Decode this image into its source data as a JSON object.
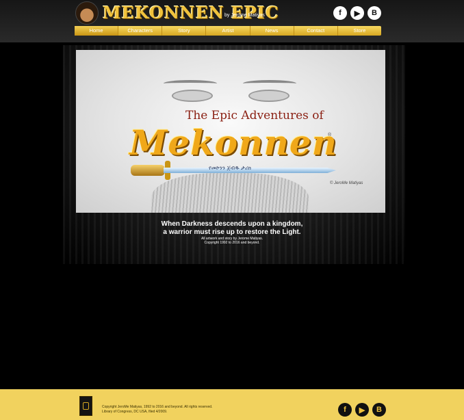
{
  "header": {
    "logo_text": "MEKONNEN EPIC",
    "byline": "by Jerome Matiyas",
    "social": [
      {
        "icon": "facebook-icon",
        "glyph": "f"
      },
      {
        "icon": "youtube-icon",
        "glyph": "▶"
      },
      {
        "icon": "blogger-icon",
        "glyph": "B"
      }
    ]
  },
  "nav": {
    "items": [
      "Home",
      "Characters",
      "Story",
      "Artist",
      "News",
      "Contact",
      "Store"
    ],
    "active": "Home"
  },
  "banner": {
    "title_line1": "The Epic Adventures of",
    "title_line2": "Mekonnen",
    "registered_mark": "®",
    "ethiopic_script": "የመኮንን ጀብዱ ታሪክ",
    "credit": "© JeroMe Matiyas"
  },
  "tagline": {
    "line1": "When Darkness descends upon a kingdom,",
    "line2": "a warrior must rise up to restore the Light.",
    "line3": "All artwork and story by Jerome Matiyas.",
    "line4": "Copyright 1992 to 2016 and beyond."
  },
  "footer": {
    "copyright_line1": "Copyright JeroMe Matiyas, 1992 to 2016 and beyond.  All rights reserved.",
    "copyright_line2": "Library of Congress, DC USA, filed 4/2009.",
    "social": [
      {
        "icon": "facebook-icon",
        "glyph": "f"
      },
      {
        "icon": "youtube-icon",
        "glyph": "▶"
      },
      {
        "icon": "blogger-icon",
        "glyph": "B"
      }
    ]
  },
  "colors": {
    "accent": "#f0c23c",
    "footer_bg": "#f1d25e",
    "page_bg": "#000000"
  }
}
